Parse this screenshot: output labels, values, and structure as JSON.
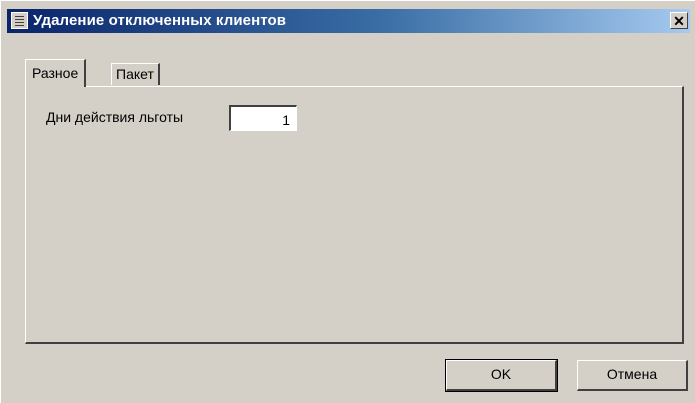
{
  "window": {
    "title": "Удаление отключенных клиентов",
    "close_glyph": "✕",
    "icon": "form-icon"
  },
  "tabs": [
    {
      "label": "Разное",
      "active": true
    },
    {
      "label": "Пакет",
      "active": false
    }
  ],
  "panel": {
    "field_label": "Дни действия льготы",
    "field_value": "1"
  },
  "buttons": {
    "ok_label": "OK",
    "cancel_label": "Отмена"
  }
}
